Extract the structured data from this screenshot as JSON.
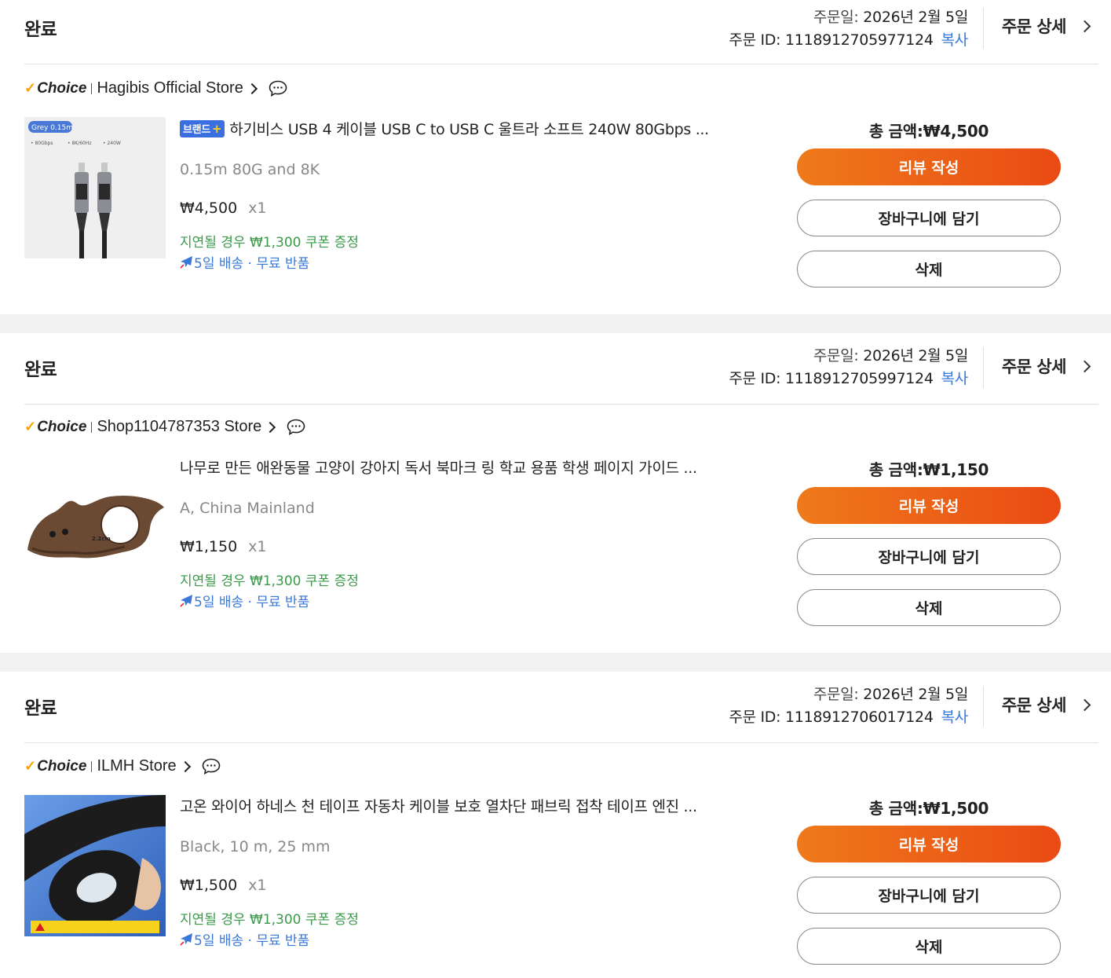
{
  "orders": [
    {
      "status": "완료",
      "order_date_label": "주문일:",
      "order_date": "2026년 2월 5일",
      "order_id_label": "주문 ID:",
      "order_id": "1118912705977124",
      "copy_label": "복사",
      "detail_label": "주문 상세",
      "choice_label": "Choice",
      "store_name": "Hagibis Official Store",
      "has_brand_badge": true,
      "brand_badge": "브랜드",
      "brand_badge_plus": "+",
      "title": "하기비스 USB 4 케이블 USB C to USB C 울트라 소프트 240W 80Gbps ...",
      "variant": "0.15m 80G and 8K",
      "price": "₩4,500",
      "qty": "x1",
      "coupon": "지연될 경우 ₩1,300 쿠폰 증정",
      "shipping": "5일 배송 · 무료 반품",
      "total": "총 금액:₩4,500",
      "btn_review": "리뷰 작성",
      "btn_cart": "장바구니에 담기",
      "btn_delete": "삭제",
      "image_text": {
        "tag": "Grey 0.15m",
        "spec1": "• 80Gbps",
        "spec2": "• 8K/60Hz",
        "spec3": "• 240W"
      }
    },
    {
      "status": "완료",
      "order_date_label": "주문일:",
      "order_date": "2026년 2월 5일",
      "order_id_label": "주문 ID:",
      "order_id": "1118912705997124",
      "copy_label": "복사",
      "detail_label": "주문 상세",
      "choice_label": "Choice",
      "store_name": "Shop1104787353 Store",
      "has_brand_badge": false,
      "title": "나무로 만든 애완동물 고양이 강아지 독서 북마크 링 학교 용품 학생 페이지 가이드 ...",
      "variant": "A, China Mainland",
      "price": "₩1,150",
      "qty": "x1",
      "coupon": "지연될 경우 ₩1,300 쿠폰 증정",
      "shipping": "5일 배송 · 무료 반품",
      "total": "총 금액:₩1,150",
      "btn_review": "리뷰 작성",
      "btn_cart": "장바구니에 담기",
      "btn_delete": "삭제",
      "image_text": {
        "dim": "2.2cm"
      }
    },
    {
      "status": "완료",
      "order_date_label": "주문일:",
      "order_date": "2026년 2월 5일",
      "order_id_label": "주문 ID:",
      "order_id": "1118912706017124",
      "copy_label": "복사",
      "detail_label": "주문 상세",
      "choice_label": "Choice",
      "store_name": "ILMH Store",
      "has_brand_badge": false,
      "title": "고온 와이어 하네스 천 테이프 자동차 케이블 보호 열차단 패브릭 접착 테이프 엔진 ...",
      "variant": "Black, 10 m, 25 mm",
      "price": "₩1,500",
      "qty": "x1",
      "coupon": "지연될 경우 ₩1,300 쿠폰 증정",
      "shipping": "5일 배송 · 무료 반품",
      "total": "총 금액:₩1,500",
      "btn_review": "리뷰 작성",
      "btn_cart": "장바구니에 담기",
      "btn_delete": "삭제"
    }
  ],
  "colors": {
    "accent_start": "#ef7a1a",
    "accent_end": "#ea4a14",
    "link_blue": "#3a78d8",
    "coupon_green": "#3a9a4a",
    "choice_check": "#f5a300"
  }
}
